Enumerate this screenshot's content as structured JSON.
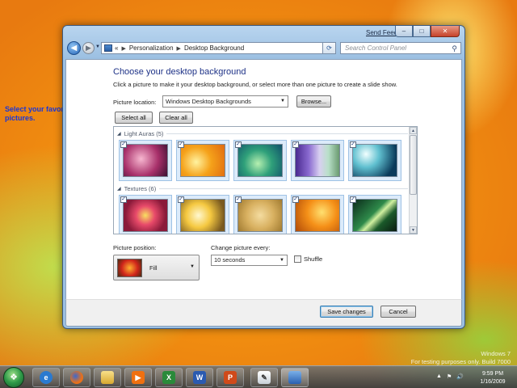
{
  "annotation": {
    "text": "Select your favorite pictures."
  },
  "window": {
    "send_feedback": "Send Feedback",
    "caption": {
      "minimize": "–",
      "maximize": "□",
      "close": "✕"
    }
  },
  "address_bar": {
    "overflow": "«",
    "crumbs": [
      "Personalization",
      "Desktop Background"
    ],
    "search_placeholder": "Search Control Panel"
  },
  "content": {
    "heading": "Choose your desktop background",
    "subtext": "Click a picture to make it your desktop background, or select more than one picture to create a slide show.",
    "picture_location_label": "Picture location:",
    "picture_location_value": "Windows Desktop Backgrounds",
    "browse_label": "Browse...",
    "select_all_label": "Select all",
    "clear_all_label": "Clear all",
    "groups": [
      {
        "label": "Light Auras (5)",
        "count": 5,
        "all_checked": true
      },
      {
        "label": "Textures (6)",
        "count": 6,
        "all_checked": true
      }
    ],
    "picture_position_label": "Picture position:",
    "picture_position_value": "Fill",
    "change_every_label": "Change picture every:",
    "change_every_value": "10 seconds",
    "shuffle_label": "Shuffle",
    "shuffle_checked": false
  },
  "footer": {
    "save_label": "Save changes",
    "cancel_label": "Cancel"
  },
  "taskbar": {
    "apps": [
      "start-orb",
      "internet-explorer-icon",
      "firefox-icon",
      "windows-explorer-icon",
      "media-player-icon",
      "excel-icon",
      "word-icon",
      "powerpoint-icon",
      "notepad-icon",
      "control-panel-icon"
    ],
    "time": "9:59 PM",
    "date": "1/16/2009"
  },
  "watermark": {
    "line1": "Windows 7",
    "line2": "For testing purposes only. Build 7000"
  },
  "colors": {
    "accent": "#1e3287",
    "annotation": "#1a36d8",
    "selection": "#dcebfa"
  }
}
